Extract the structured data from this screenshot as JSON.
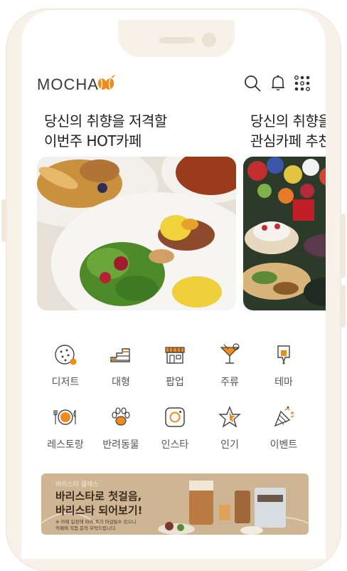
{
  "header": {
    "logo_text": "MOCHA",
    "icons": [
      "search-icon",
      "bell-icon",
      "grid-menu-icon"
    ]
  },
  "carousel": {
    "cards": [
      {
        "title_line1": "당신의 취향을 저격할",
        "title_line2": "이번주 HOT카페"
      },
      {
        "title_line1": "당신의 취향을",
        "title_line2": "관심카페 추천"
      }
    ]
  },
  "categories": [
    {
      "label": "디저트",
      "icon": "cookie-icon"
    },
    {
      "label": "대형",
      "icon": "stairs-icon"
    },
    {
      "label": "팝업",
      "icon": "storefront-icon"
    },
    {
      "label": "주류",
      "icon": "cocktail-icon"
    },
    {
      "label": "테마",
      "icon": "theme-icon"
    },
    {
      "label": "레스토랑",
      "icon": "plate-cutlery-icon"
    },
    {
      "label": "반려동물",
      "icon": "paw-icon"
    },
    {
      "label": "인스타",
      "icon": "instagram-icon"
    },
    {
      "label": "인기",
      "icon": "star-icon"
    },
    {
      "label": "이벤트",
      "icon": "party-popper-icon"
    }
  ],
  "banner": {
    "small_text": "바리스타 클래스",
    "title_line1": "바리스타로 첫걸음,",
    "title_line2": "바리스타 되어보기!",
    "note_line1": "※ 카페 일정에 따라 조기 마감될수 있으니",
    "note_line2": "카페에 직접 문의 부탁드립니다."
  },
  "colors": {
    "accent": "#f08a1c",
    "frame": "#f7f1e8",
    "banner_bg": "#ceb594"
  }
}
